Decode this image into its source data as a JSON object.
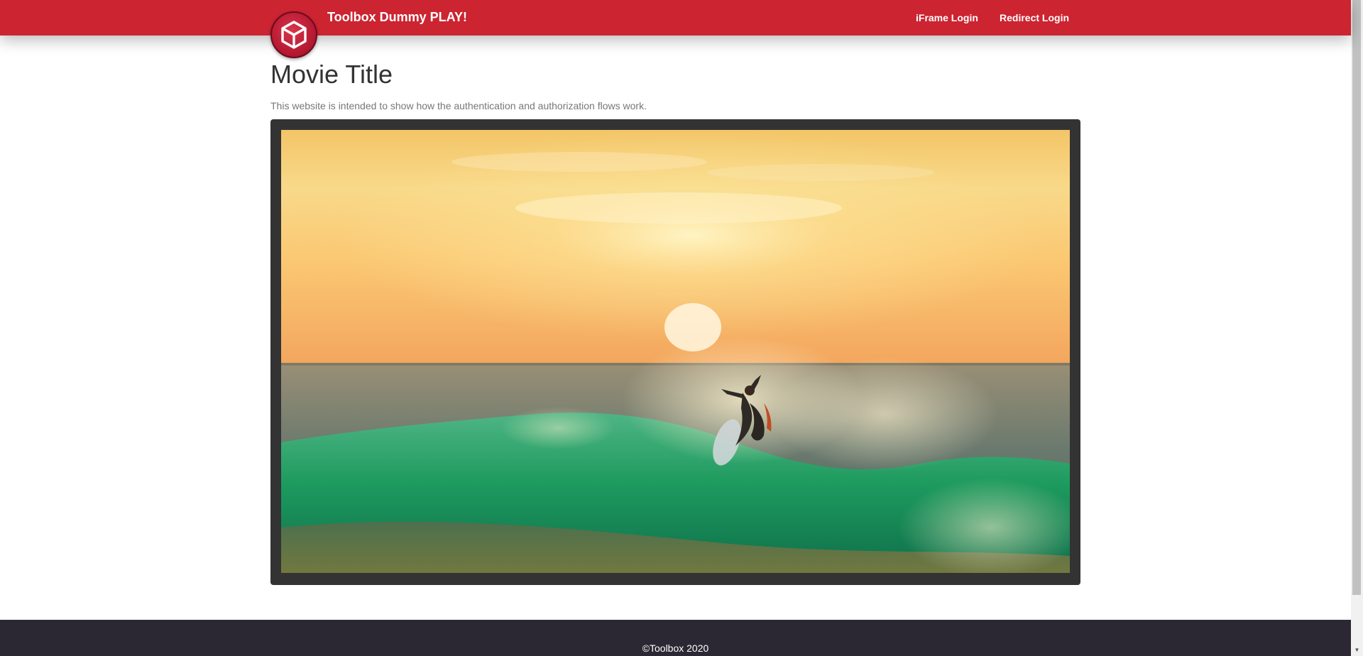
{
  "header": {
    "brand": "Toolbox Dummy PLAY!",
    "logo_icon": "cube-icon",
    "nav": {
      "iframe_login": "iFrame Login",
      "redirect_login": "Redirect Login"
    }
  },
  "main": {
    "title": "Movie Title",
    "description": "This website is intended to show how the authentication and authorization flows work.",
    "video": {
      "scene": "surfer-on-wave-at-sunset"
    }
  },
  "footer": {
    "copyright": "©Toolbox 2020"
  },
  "colors": {
    "navbar": "#cc2431",
    "footer": "#2b2833",
    "player_frame": "#333333"
  }
}
